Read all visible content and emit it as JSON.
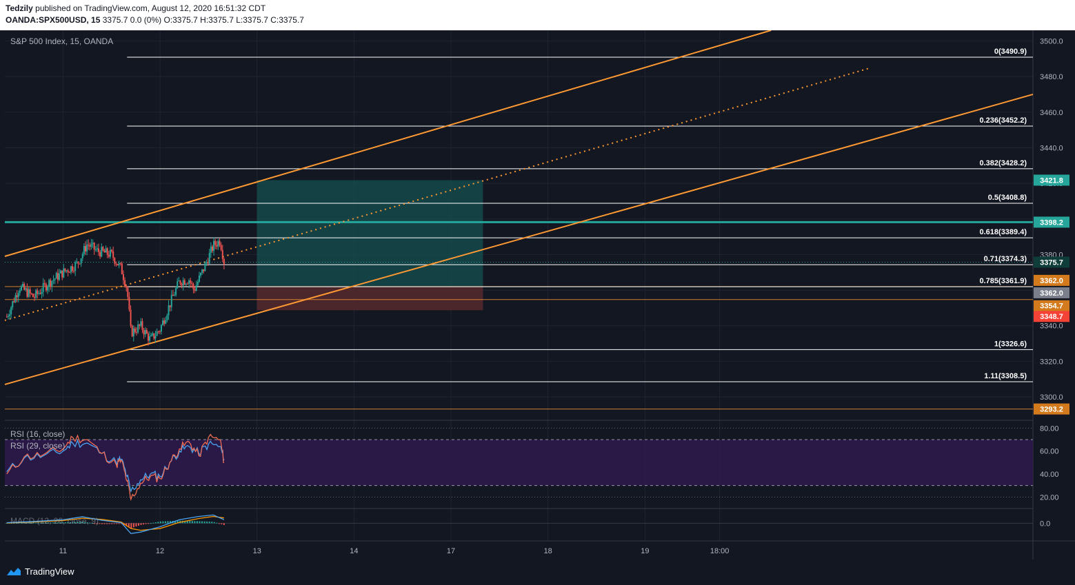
{
  "header": {
    "author": "Tedzily",
    "published_text": "published on TradingView.com, August 12, 2020 16:51:32 CDT",
    "symbol": "OANDA:SPX500USD, 15",
    "ohlc_text": "3375.7 0.0 (0%) O:3375.7 H:3375.7 L:3375.7 C:3375.7"
  },
  "footer": {
    "brand": "TradingView"
  },
  "colors": {
    "background": "#131722",
    "grid": "#1f2430",
    "up": "#26a69a",
    "down": "#ef5350",
    "channel": "#ff9933",
    "fib": "#ffffff",
    "tp_zone": "#155050",
    "sl_zone": "#5a2a2e",
    "resistance": "#26a69a",
    "rsi_fill": "#2e1a4a",
    "rsi16": "#ef6c52",
    "rsi29": "#4aa3f0",
    "macd": "#4aa3f0",
    "signal": "#ff9800",
    "price_tag_current": "#26a69a",
    "price_tag_orange": "#d37a1c",
    "price_tag_red": "#f44336",
    "price_tag_gray": "#7b7f8b"
  },
  "chart_data": {
    "type": "candlestick",
    "title": "S&P 500 Index, 15, OANDA",
    "ylim": [
      3288,
      3506
    ],
    "y_ticks": [
      3300,
      3320,
      3340,
      3360,
      3380,
      3400,
      3420,
      3440,
      3460,
      3480,
      3500
    ],
    "y_tick_labels": [
      "3300.0",
      "3320.0",
      "3340.0",
      "3360.0",
      "3380.0",
      "3400.0",
      "3420.0",
      "3440.0",
      "3460.0",
      "3480.0",
      "3500.0"
    ],
    "x_labels": [
      "11",
      "12",
      "13",
      "14",
      "17",
      "18",
      "19",
      "18:00"
    ],
    "xlim": [
      10.4,
      21.0
    ],
    "x_label_positions": [
      11,
      12,
      13,
      14,
      15,
      16,
      17,
      17.77
    ],
    "price_path": [
      [
        10.42,
        3345
      ],
      [
        10.55,
        3362
      ],
      [
        10.7,
        3356
      ],
      [
        10.85,
        3364
      ],
      [
        11.0,
        3370
      ],
      [
        11.15,
        3375
      ],
      [
        11.25,
        3386
      ],
      [
        11.35,
        3382
      ],
      [
        11.5,
        3380
      ],
      [
        11.6,
        3372
      ],
      [
        11.66,
        3361
      ],
      [
        11.7,
        3336
      ],
      [
        11.8,
        3340
      ],
      [
        11.9,
        3332
      ],
      [
        12.0,
        3338
      ],
      [
        12.1,
        3352
      ],
      [
        12.2,
        3365
      ],
      [
        12.3,
        3366
      ],
      [
        12.35,
        3360
      ],
      [
        12.45,
        3372
      ],
      [
        12.55,
        3385
      ],
      [
        12.62,
        3388
      ],
      [
        12.66,
        3376
      ]
    ],
    "fib_levels": [
      {
        "label": "0(3490.9)",
        "price": 3490.9
      },
      {
        "label": "0.236(3452.2)",
        "price": 3452.2
      },
      {
        "label": "0.382(3428.2)",
        "price": 3428.2
      },
      {
        "label": "0.5(3408.8)",
        "price": 3408.8
      },
      {
        "label": "0.618(3389.4)",
        "price": 3389.4
      },
      {
        "label": "0.71(3374.3)",
        "price": 3374.3
      },
      {
        "label": "0.785(3361.9)",
        "price": 3361.9
      },
      {
        "label": "1(3326.6)",
        "price": 3326.6
      },
      {
        "label": "1.11(3308.5)",
        "price": 3308.5
      }
    ],
    "fib_x_range": [
      11.66,
      21.0
    ],
    "channel": {
      "upper": [
        [
          10.4,
          3379
        ],
        [
          18.3,
          3506
        ]
      ],
      "lower": [
        [
          10.4,
          3307
        ],
        [
          21.0,
          3470
        ]
      ],
      "mid": [
        [
          10.4,
          3343
        ],
        [
          19.3,
          3484.5
        ]
      ]
    },
    "position": {
      "x_range": [
        13.0,
        15.33
      ],
      "entry": 3362.0,
      "target": 3421.8,
      "stop": 3348.7
    },
    "horizontal_lines": [
      {
        "price": 3398.2,
        "color": "resistance",
        "width": 3
      },
      {
        "price": 3362.0,
        "color": "channel",
        "width": 1
      },
      {
        "price": 3354.7,
        "color": "channel",
        "width": 1
      },
      {
        "price": 3293.2,
        "color": "channel",
        "width": 1
      },
      {
        "price": 3375.7,
        "color": "current",
        "width": 1,
        "dotted": true
      }
    ],
    "price_tags": [
      {
        "text": "3421.8",
        "price": 3421.8,
        "color": "price_tag_current"
      },
      {
        "text": "3398.2",
        "price": 3398.2,
        "color": "price_tag_current"
      },
      {
        "text": "3375.7",
        "price": 3375.7,
        "color": "price_tag_current_dark"
      },
      {
        "text": "3362.0",
        "price": 3362.0,
        "color": "price_tag_orange",
        "offset": -7
      },
      {
        "text": "3362.0",
        "price": 3362.0,
        "color": "price_tag_gray",
        "offset": 11
      },
      {
        "text": "3354.7",
        "price": 3354.7,
        "color": "price_tag_orange",
        "offset": 11
      },
      {
        "text": "3348.7",
        "price": 3348.7,
        "color": "price_tag_red",
        "offset": 11
      },
      {
        "text": "3293.2",
        "price": 3293.2,
        "color": "price_tag_orange"
      }
    ],
    "rsi": {
      "labels": [
        "RSI (16, close)",
        "RSI (29, close)"
      ],
      "ylim": [
        10,
        85
      ],
      "y_ticks": [
        20,
        40,
        60,
        80
      ],
      "y_tick_labels": [
        "20.00",
        "40.00",
        "60.00",
        "80.00"
      ],
      "band": [
        30,
        70
      ],
      "rsi16": [
        [
          10.42,
          40
        ],
        [
          10.6,
          55
        ],
        [
          10.8,
          57
        ],
        [
          11.0,
          62
        ],
        [
          11.1,
          72
        ],
        [
          11.25,
          70
        ],
        [
          11.4,
          58
        ],
        [
          11.55,
          48
        ],
        [
          11.6,
          52
        ],
        [
          11.66,
          34
        ],
        [
          11.7,
          18
        ],
        [
          11.8,
          32
        ],
        [
          11.9,
          38
        ],
        [
          12.0,
          36
        ],
        [
          12.1,
          50
        ],
        [
          12.2,
          62
        ],
        [
          12.3,
          68
        ],
        [
          12.4,
          56
        ],
        [
          12.5,
          72
        ],
        [
          12.62,
          70
        ],
        [
          12.66,
          50
        ]
      ],
      "rsi29": [
        [
          10.42,
          42
        ],
        [
          10.6,
          54
        ],
        [
          10.8,
          56
        ],
        [
          11.0,
          60
        ],
        [
          11.1,
          67
        ],
        [
          11.25,
          67
        ],
        [
          11.4,
          58
        ],
        [
          11.55,
          50
        ],
        [
          11.6,
          53
        ],
        [
          11.66,
          38
        ],
        [
          11.7,
          25
        ],
        [
          11.8,
          35
        ],
        [
          11.9,
          40
        ],
        [
          12.0,
          38
        ],
        [
          12.1,
          50
        ],
        [
          12.2,
          60
        ],
        [
          12.3,
          64
        ],
        [
          12.4,
          58
        ],
        [
          12.5,
          66
        ],
        [
          12.62,
          64
        ],
        [
          12.66,
          53
        ]
      ]
    },
    "macd": {
      "label": "MACD (12, 26, close, 9)",
      "ylim": [
        -6,
        5
      ],
      "y_ticks": [
        0
      ],
      "y_tick_labels": [
        "0.0"
      ],
      "macd_line": [
        [
          10.42,
          0.2
        ],
        [
          10.7,
          0.6
        ],
        [
          11.0,
          1.2
        ],
        [
          11.2,
          2.2
        ],
        [
          11.4,
          1.0
        ],
        [
          11.6,
          0.2
        ],
        [
          11.7,
          -3.5
        ],
        [
          11.8,
          -3.0
        ],
        [
          12.0,
          -1.2
        ],
        [
          12.2,
          1.2
        ],
        [
          12.4,
          2.3
        ],
        [
          12.55,
          2.8
        ],
        [
          12.66,
          1.2
        ]
      ],
      "signal_line": [
        [
          10.42,
          0.1
        ],
        [
          10.7,
          0.4
        ],
        [
          11.0,
          0.9
        ],
        [
          11.2,
          1.7
        ],
        [
          11.4,
          1.3
        ],
        [
          11.6,
          0.4
        ],
        [
          11.7,
          -1.8
        ],
        [
          11.8,
          -2.4
        ],
        [
          12.0,
          -1.8
        ],
        [
          12.2,
          0.3
        ],
        [
          12.4,
          1.6
        ],
        [
          12.55,
          2.3
        ],
        [
          12.66,
          1.8
        ]
      ]
    }
  }
}
